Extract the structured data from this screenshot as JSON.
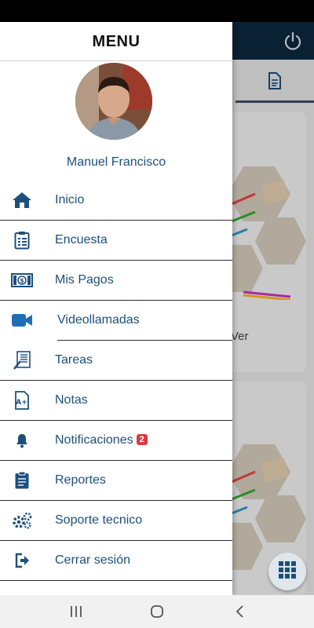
{
  "drawer": {
    "title": "MENU",
    "user_name": "Manuel Francisco"
  },
  "menu": [
    {
      "id": "inicio",
      "label": "Inicio",
      "icon": "home-icon"
    },
    {
      "id": "encuesta",
      "label": "Encuesta",
      "icon": "clipboard-list-icon"
    },
    {
      "id": "mis-pagos",
      "label": "Mis Pagos",
      "icon": "money-bill-icon"
    },
    {
      "id": "videollamadas",
      "label": "Videollamadas",
      "icon": "video-camera-icon"
    },
    {
      "id": "tareas",
      "label": "Tareas",
      "icon": "task-sheet-icon"
    },
    {
      "id": "notas",
      "label": "Notas",
      "icon": "grade-file-icon"
    },
    {
      "id": "notificaciones",
      "label": "Notificaciones",
      "icon": "bell-icon",
      "badge": "2"
    },
    {
      "id": "reportes",
      "label": "Reportes",
      "icon": "clipboard-icon"
    },
    {
      "id": "soporte",
      "label": "Soporte tecnico",
      "icon": "gears-icon"
    },
    {
      "id": "cerrar",
      "label": "Cerrar sesión",
      "icon": "sign-out-icon"
    }
  ],
  "background": {
    "card_action": "Ver",
    "header_icon": "power-icon",
    "tab_icon": "document-icon",
    "fab_icon": "grid-icon"
  },
  "colors": {
    "accent": "#1d4f7c",
    "header": "#0d2940",
    "badge": "#e0393b"
  },
  "nav_bar": {
    "icons": [
      "recent-apps-icon",
      "home-circle-icon",
      "back-icon"
    ]
  }
}
